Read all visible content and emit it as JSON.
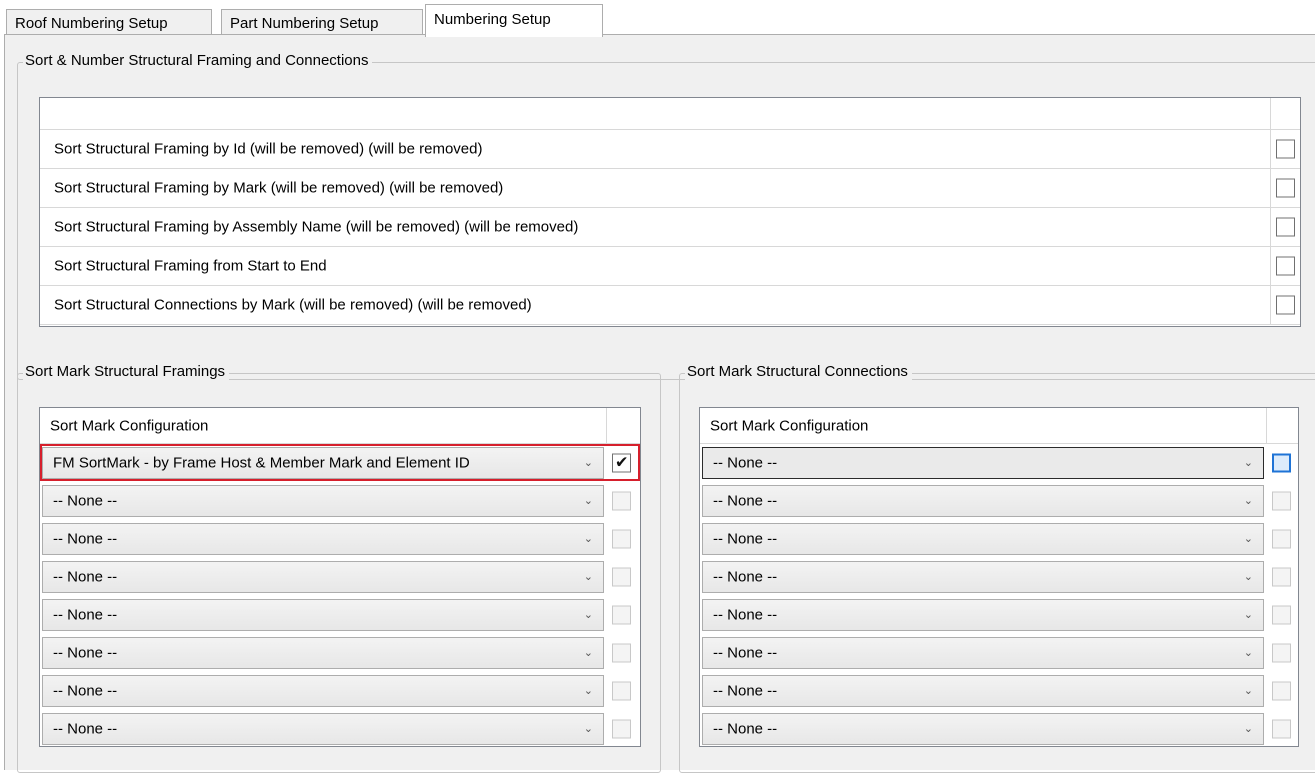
{
  "tabs": [
    {
      "label": "Roof Numbering Setup"
    },
    {
      "label": "Part Numbering Setup"
    },
    {
      "label": "Numbering Setup"
    }
  ],
  "sort_number_group": {
    "title": "Sort & Number Structural Framing and Connections",
    "rows": [
      {
        "label": "Sort Structural Framing by Id (will be removed) (will be removed)",
        "checked": false
      },
      {
        "label": "Sort Structural Framing by Mark (will be removed) (will be removed)",
        "checked": false
      },
      {
        "label": "Sort Structural Framing by Assembly Name (will be removed) (will be removed)",
        "checked": false
      },
      {
        "label": "Sort Structural Framing from Start to End",
        "checked": false
      },
      {
        "label": "Sort Structural Connections by Mark (will be removed) (will be removed)",
        "checked": false
      }
    ]
  },
  "framings_group": {
    "title": "Sort Mark Structural Framings",
    "header": "Sort Mark Configuration",
    "rows": [
      {
        "value": "FM SortMark - by Frame Host & Member Mark and Element ID",
        "checked": true
      },
      {
        "value": "-- None --",
        "checked": false
      },
      {
        "value": "-- None --",
        "checked": false
      },
      {
        "value": "-- None --",
        "checked": false
      },
      {
        "value": "-- None --",
        "checked": false
      },
      {
        "value": "-- None --",
        "checked": false
      },
      {
        "value": "-- None --",
        "checked": false
      },
      {
        "value": "-- None --",
        "checked": false
      }
    ]
  },
  "connections_group": {
    "title": "Sort Mark Structural Connections",
    "header": "Sort Mark Configuration",
    "rows": [
      {
        "value": "-- None --",
        "checked": false
      },
      {
        "value": "-- None --",
        "checked": false
      },
      {
        "value": "-- None --",
        "checked": false
      },
      {
        "value": "-- None --",
        "checked": false
      },
      {
        "value": "-- None --",
        "checked": false
      },
      {
        "value": "-- None --",
        "checked": false
      },
      {
        "value": "-- None --",
        "checked": false
      },
      {
        "value": "-- None --",
        "checked": false
      }
    ]
  },
  "colors": {
    "highlight": "#d61f2c",
    "focus": "#1e73d6"
  }
}
